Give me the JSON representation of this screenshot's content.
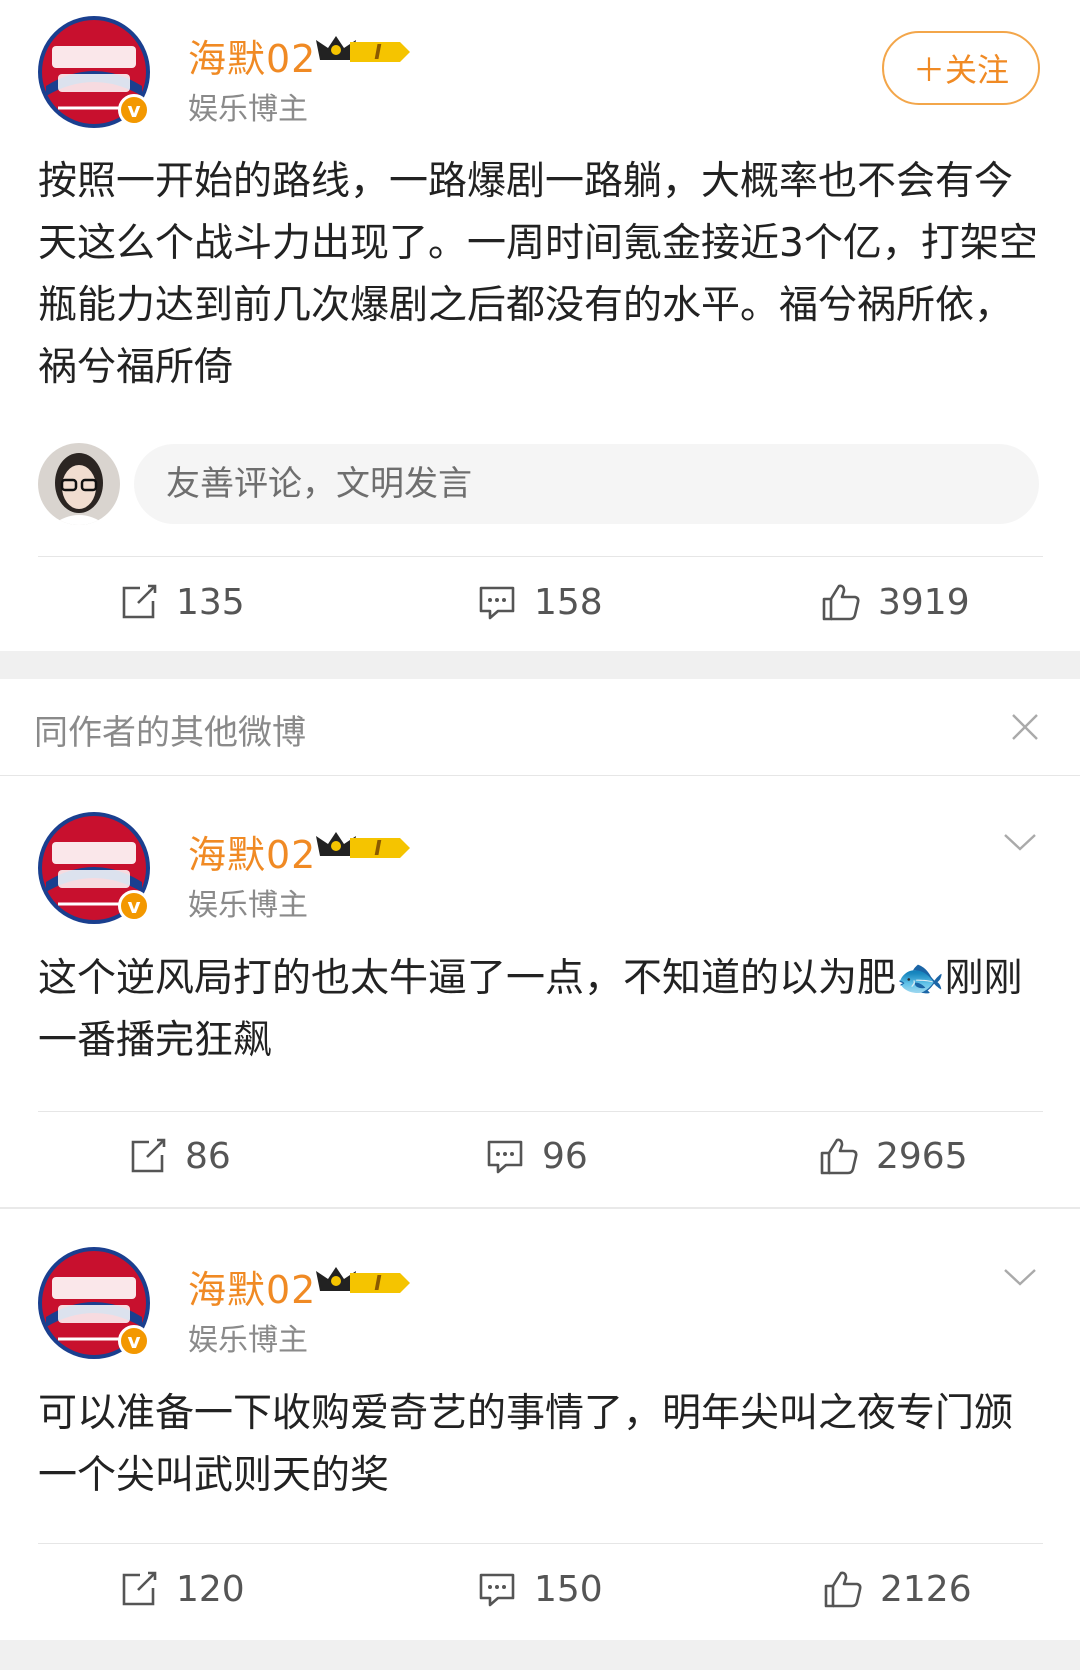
{
  "main_post": {
    "author": "海默02",
    "level_badge": "I",
    "role": "娱乐博主",
    "follow_label": "＋关注",
    "text": "按照一开始的路线，一路爆剧一路躺，大概率也不会有今天这么个战斗力出现了。一周时间氪金接近3个亿，打架空瓶能力达到前几次爆剧之后都没有的水平。福兮祸所依，祸兮福所倚",
    "comment_placeholder": "友善评论，文明发言",
    "reposts": "135",
    "comments": "158",
    "likes": "3919"
  },
  "more_section": {
    "title": "同作者的其他微博"
  },
  "posts": [
    {
      "author": "海默02",
      "level_badge": "I",
      "role": "娱乐博主",
      "text": "这个逆风局打的也太牛逼了一点，不知道的以为肥🐟刚刚一番播完狂飙",
      "reposts": "86",
      "comments": "96",
      "likes": "2965"
    },
    {
      "author": "海默02",
      "level_badge": "I",
      "role": "娱乐博主",
      "text": "可以准备一下收购爱奇艺的事情了，明年尖叫之夜专门颁一个尖叫武则天的奖",
      "reposts": "120",
      "comments": "150",
      "likes": "2126"
    }
  ],
  "colors": {
    "accent": "#f08a24",
    "muted": "#8a8a8a",
    "gap": "#f0f0f0"
  }
}
